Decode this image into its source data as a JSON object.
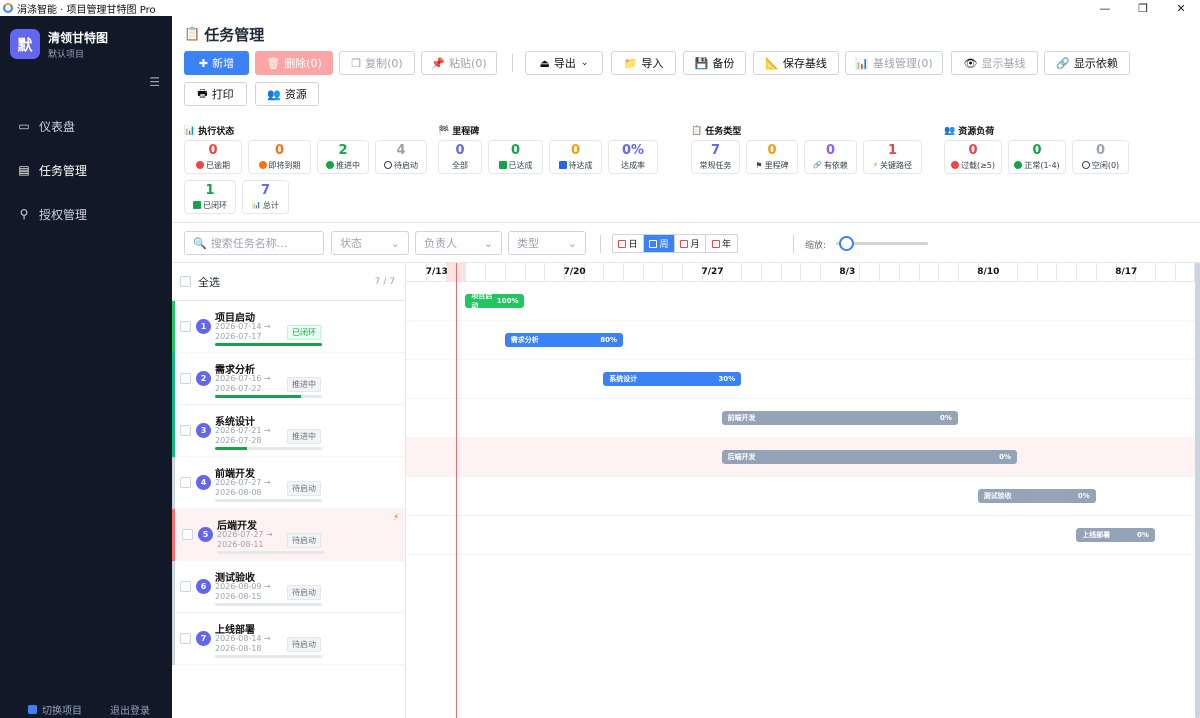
{
  "window": {
    "title": "涓涤智能 · 项目管理甘特图 Pro",
    "min": "—",
    "max": "❐",
    "close": "✕"
  },
  "sidebar": {
    "avatar": "默",
    "app_name": "清领甘特图",
    "project": "默认项目",
    "toggle": "☰",
    "items": [
      {
        "icon": "▭",
        "label": "仪表盘"
      },
      {
        "icon": "▤",
        "label": "任务管理"
      },
      {
        "icon": "⚲",
        "label": "授权管理"
      }
    ],
    "switch_project": "切换项目",
    "logout": "退出登录"
  },
  "page_title": "任务管理",
  "toolbar": {
    "new": "新增",
    "delete": "删除(0)",
    "copy": "复制(0)",
    "paste": "粘贴(0)",
    "export": "导出",
    "import": "导入",
    "backup": "备份",
    "save_baseline": "保存基线",
    "baseline_mgmt": "基线管理(0)",
    "show_baseline": "显示基线",
    "show_deps": "显示依赖",
    "print": "打印",
    "resource": "资源"
  },
  "stats": {
    "exec": {
      "title": "执行状态",
      "cards": [
        {
          "value": "0",
          "label": "已逾期",
          "color": "#ef4444"
        },
        {
          "value": "0",
          "label": "即将到期",
          "color": "#f97316"
        },
        {
          "value": "2",
          "label": "推进中",
          "color": "#16a34a"
        },
        {
          "value": "4",
          "label": "待启动",
          "color": "#9ca3af"
        },
        {
          "value": "1",
          "label": "已闭环",
          "color": "#16a34a"
        },
        {
          "value": "7",
          "label": "总计",
          "color": "#6366f1"
        }
      ]
    },
    "milestone": {
      "title": "里程碑",
      "cards": [
        {
          "value": "0",
          "label": "全部",
          "color": "#6366f1"
        },
        {
          "value": "0",
          "label": "已达成",
          "color": "#16a34a"
        },
        {
          "value": "0",
          "label": "待达成",
          "color": "#f59e0b"
        },
        {
          "value": "0%",
          "label": "达成率",
          "color": "#6366f1"
        }
      ]
    },
    "type": {
      "title": "任务类型",
      "cards": [
        {
          "value": "7",
          "label": "常规任务",
          "color": "#6366f1"
        },
        {
          "value": "0",
          "label": "里程碑",
          "color": "#f59e0b"
        },
        {
          "value": "0",
          "label": "有依赖",
          "color": "#8b5cf6"
        },
        {
          "value": "1",
          "label": "关键路径",
          "color": "#ef4444"
        }
      ]
    },
    "load": {
      "title": "资源负荷",
      "cards": [
        {
          "value": "0",
          "label": "过载(≥5)",
          "color": "#ef4444"
        },
        {
          "value": "0",
          "label": "正常(1-4)",
          "color": "#16a34a"
        },
        {
          "value": "0",
          "label": "空闲(0)",
          "color": "#9ca3af"
        }
      ]
    }
  },
  "filters": {
    "search_placeholder": "搜索任务名称...",
    "status": "状态",
    "owner": "负责人",
    "type": "类型",
    "zoom_label": "缩放:",
    "zoom_level": 0.08
  },
  "views": [
    {
      "label": "日"
    },
    {
      "label": "周",
      "active": true
    },
    {
      "label": "月"
    },
    {
      "label": "年"
    }
  ],
  "list": {
    "select_all": "全选",
    "count": "7 / 7"
  },
  "tasks": [
    {
      "n": "1",
      "name": "项目启动",
      "start": "2026-07-14 →",
      "end": "2026-07-17",
      "status": "已闭环",
      "progress": 1.0,
      "accent": "#22c55e"
    },
    {
      "n": "2",
      "name": "需求分析",
      "start": "2026-07-16 →",
      "end": "2026-07-22",
      "status": "推进中",
      "progress": 0.8,
      "accent": "#10b981"
    },
    {
      "n": "3",
      "name": "系统设计",
      "start": "2026-07-21 →",
      "end": "2026-07-28",
      "status": "推进中",
      "progress": 0.3,
      "accent": "#10b981"
    },
    {
      "n": "4",
      "name": "前端开发",
      "start": "2026-07-27 →",
      "end": "2026-08-08",
      "status": "待启动",
      "progress": 0,
      "accent": "#cbd5e1"
    },
    {
      "n": "5",
      "name": "后端开发",
      "start": "2026-07-27 →",
      "end": "2026-08-11",
      "status": "待启动",
      "progress": 0,
      "accent": "#f87171",
      "critical": true,
      "bolt": "⚡"
    },
    {
      "n": "6",
      "name": "测试验收",
      "start": "2026-08-09 →",
      "end": "2026-08-15",
      "status": "待启动",
      "progress": 0,
      "accent": "#cbd5e1"
    },
    {
      "n": "7",
      "name": "上线部署",
      "start": "2026-08-14 →",
      "end": "2026-08-18",
      "status": "待启动",
      "progress": 0,
      "accent": "#cbd5e1"
    }
  ],
  "gantt": {
    "headers": [
      {
        "label": "7/13",
        "date": "2026-07-13"
      },
      {
        "label": "7/20",
        "date": "2026-07-20"
      },
      {
        "label": "7/27",
        "date": "2026-07-27"
      },
      {
        "label": "8/3",
        "date": "2026-08-03"
      },
      {
        "label": "8/10",
        "date": "2026-08-10"
      },
      {
        "label": "8/17",
        "date": "2026-08-17"
      }
    ],
    "today": "2026-07-13",
    "bars": [
      {
        "name": "项目启动",
        "start": "2026-07-14",
        "end": "2026-07-17",
        "pct": "100%",
        "color": "#22c55e"
      },
      {
        "name": "需求分析",
        "start": "2026-07-16",
        "end": "2026-07-22",
        "pct": "80%",
        "color": "#3b82f6"
      },
      {
        "name": "系统设计",
        "start": "2026-07-21",
        "end": "2026-07-28",
        "pct": "30%",
        "color": "#3b82f6"
      },
      {
        "name": "前端开发",
        "start": "2026-07-27",
        "end": "2026-08-08",
        "pct": "0%",
        "color": "#94a3b8"
      },
      {
        "name": "后端开发",
        "start": "2026-07-27",
        "end": "2026-08-11",
        "pct": "0%",
        "color": "#94a3b8"
      },
      {
        "name": "测试验收",
        "start": "2026-08-09",
        "end": "2026-08-15",
        "pct": "0%",
        "color": "#94a3b8"
      },
      {
        "name": "上线部署",
        "start": "2026-08-14",
        "end": "2026-08-18",
        "pct": "0%",
        "color": "#94a3b8"
      }
    ]
  }
}
